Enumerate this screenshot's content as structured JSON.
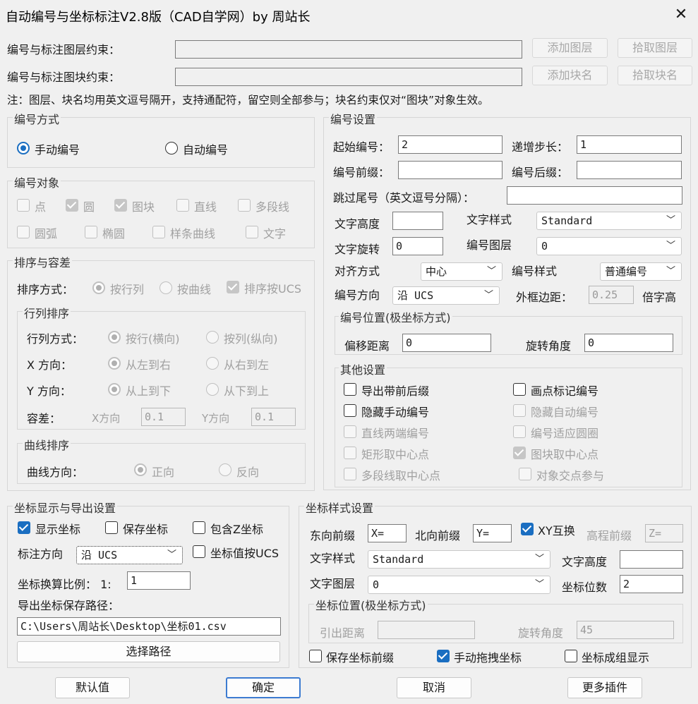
{
  "window": {
    "title": "自动编号与坐标标注V2.8版（CAD自学网）by 周站长",
    "close": "✕"
  },
  "layer": {
    "label": "编号与标注图层约束：",
    "value": "",
    "add": "添加图层",
    "pick": "拾取图层"
  },
  "block": {
    "label": "编号与标注图块约束：",
    "value": "",
    "add": "添加块名",
    "pick": "拾取块名"
  },
  "note": "注：图层、块名均用英文逗号隔开，支持通配符，留空则全部参与；块名约束仅对“图块”对象生效。",
  "numbering_mode": {
    "title": "编号方式",
    "manual": "手动编号",
    "auto": "自动编号"
  },
  "objects": {
    "title": "编号对象",
    "point": "点",
    "circle": "圆",
    "block": "图块",
    "line": "直线",
    "polyline": "多段线",
    "arc": "圆弧",
    "ellipse": "椭圆",
    "spline": "样条曲线",
    "text": "文字"
  },
  "sort": {
    "title": "排序与容差",
    "method_label": "排序方式：",
    "by_row": "按行列",
    "by_curve": "按曲线",
    "by_ucs": "排序按UCS",
    "rowcol_title": "行列排序",
    "rowcol_label": "行列方式：",
    "row": "按行(横向)",
    "col": "按列(纵向)",
    "x_label": "X 方向：",
    "x_lr": "从左到右",
    "x_rl": "从右到左",
    "y_label": "Y 方向：",
    "y_tb": "从上到下",
    "y_bt": "从下到上",
    "tol_label": "容差：",
    "tol_x_label": "X方向",
    "tol_x": "0.1",
    "tol_y_label": "Y方向",
    "tol_y": "0.1",
    "curve_title": "曲线排序",
    "curve_label": "曲线方向：",
    "forward": "正向",
    "reverse": "反向"
  },
  "numset": {
    "title": "编号设置",
    "start_label": "起始编号：",
    "start": "2",
    "step_label": "递增步长：",
    "step": "1",
    "prefix_label": "编号前缀：",
    "prefix": "",
    "suffix_label": "编号后缀：",
    "suffix": "",
    "skip_label": "跳过尾号（英文逗号分隔）：",
    "skip": "",
    "height_label": "文字高度",
    "height": "",
    "style_label": "文字样式",
    "style": "Standard",
    "rot_label": "文字旋转",
    "rot": "0",
    "layer_label": "编号图层",
    "layer": "0",
    "align_label": "对齐方式",
    "align": "中心",
    "numstyle_label": "编号样式",
    "numstyle": "普通编号",
    "dir_label": "编号方向",
    "dir": "沿 UCS",
    "margin_label": "外框边距：",
    "margin": "0.25",
    "margin_unit": "倍字高",
    "pos_title": "编号位置(极坐标方式)",
    "offset_label": "偏移距离",
    "offset": "0",
    "angle_label": "旋转角度",
    "angle": "0"
  },
  "other": {
    "title": "其他设置",
    "export_fix": "导出带前后缀",
    "draw_mark": "画点标记编号",
    "hide_manual": "隐藏手动编号",
    "hide_auto": "隐藏自动编号",
    "line_ends": "直线两端编号",
    "fit_circle": "编号适应圆圈",
    "rect_center": "矩形取中心点",
    "block_center": "图块取中心点",
    "pline_center": "多段线取中心点",
    "intersect": "对象交点参与"
  },
  "coordshow": {
    "title": "坐标显示与导出设置",
    "show": "显示坐标",
    "save": "保存坐标",
    "z": "包含Z坐标",
    "dir_label": "标注方向",
    "dir": "沿 UCS",
    "by_ucs": "坐标值按UCS",
    "scale_label": "坐标换算比例：  1:",
    "scale": "1",
    "path_label": "导出坐标保存路径：",
    "path": "C:\\Users\\周站长\\Desktop\\坐标01.csv",
    "choose": "选择路径"
  },
  "coordstyle": {
    "title": "坐标样式设置",
    "east_label": "东向前缀",
    "east": "X=",
    "north_label": "北向前缀",
    "north": "Y=",
    "swap": "XY互换",
    "elev_label": "高程前缀",
    "elev": "Z=",
    "style_label": "文字样式",
    "style": "Standard",
    "height_label": "文字高度",
    "height": "",
    "layer_label": "文字图层",
    "layer": "0",
    "digits_label": "坐标位数",
    "digits": "2",
    "pos_title": "坐标位置(极坐标方式)",
    "lead_label": "引出距离",
    "lead": "",
    "angle_label": "旋转角度",
    "angle": "45",
    "save_prefix": "保存坐标前缀",
    "drag": "手动拖拽坐标",
    "group": "坐标成组显示"
  },
  "footer": {
    "default": "默认值",
    "ok": "确定",
    "cancel": "取消",
    "more": "更多插件"
  }
}
